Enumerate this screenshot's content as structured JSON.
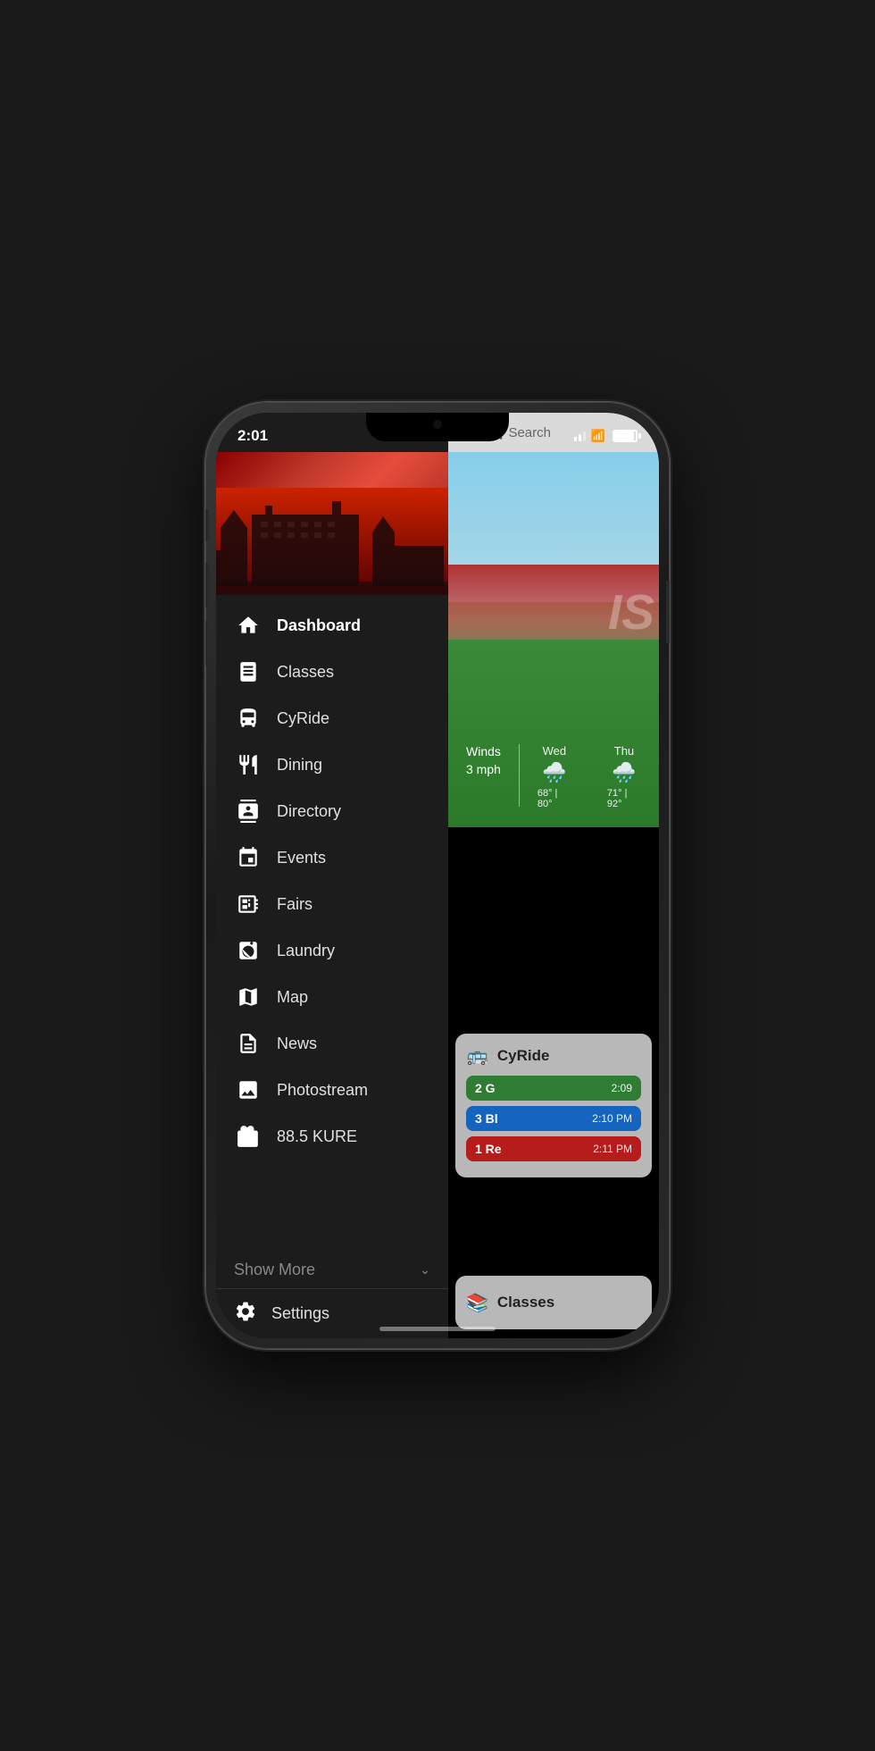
{
  "status": {
    "time": "2:01",
    "signal_dots": 3,
    "wifi": "wifi",
    "battery": "battery"
  },
  "header": {
    "search_placeholder": "Search",
    "search_label": "Search"
  },
  "menu": {
    "items": [
      {
        "id": "dashboard",
        "label": "Dashboard",
        "active": true
      },
      {
        "id": "classes",
        "label": "Classes"
      },
      {
        "id": "cyride",
        "label": "CyRide"
      },
      {
        "id": "dining",
        "label": "Dining"
      },
      {
        "id": "directory",
        "label": "Directory"
      },
      {
        "id": "events",
        "label": "Events"
      },
      {
        "id": "fairs",
        "label": "Fairs"
      },
      {
        "id": "laundry",
        "label": "Laundry"
      },
      {
        "id": "map",
        "label": "Map"
      },
      {
        "id": "news",
        "label": "News"
      },
      {
        "id": "photostream",
        "label": "Photostream"
      },
      {
        "id": "kure",
        "label": "88.5 KURE"
      }
    ],
    "show_more": "Show More",
    "settings": "Settings"
  },
  "weather": {
    "winds_label": "Winds",
    "speed": "3 mph",
    "days": [
      {
        "name": "Wed",
        "low": "68°",
        "high": "80°"
      },
      {
        "name": "Thu",
        "low": "71°",
        "high": "92°"
      }
    ]
  },
  "cyride_card": {
    "title": "CyRide",
    "routes": [
      {
        "number": "2 G",
        "time": "2:09",
        "color": "green"
      },
      {
        "number": "3 Bl",
        "time": "2:10 PM",
        "color": "blue"
      },
      {
        "number": "1 Re",
        "time": "2:11 PM",
        "color": "red"
      }
    ]
  },
  "classes_card": {
    "title": "Classes"
  }
}
